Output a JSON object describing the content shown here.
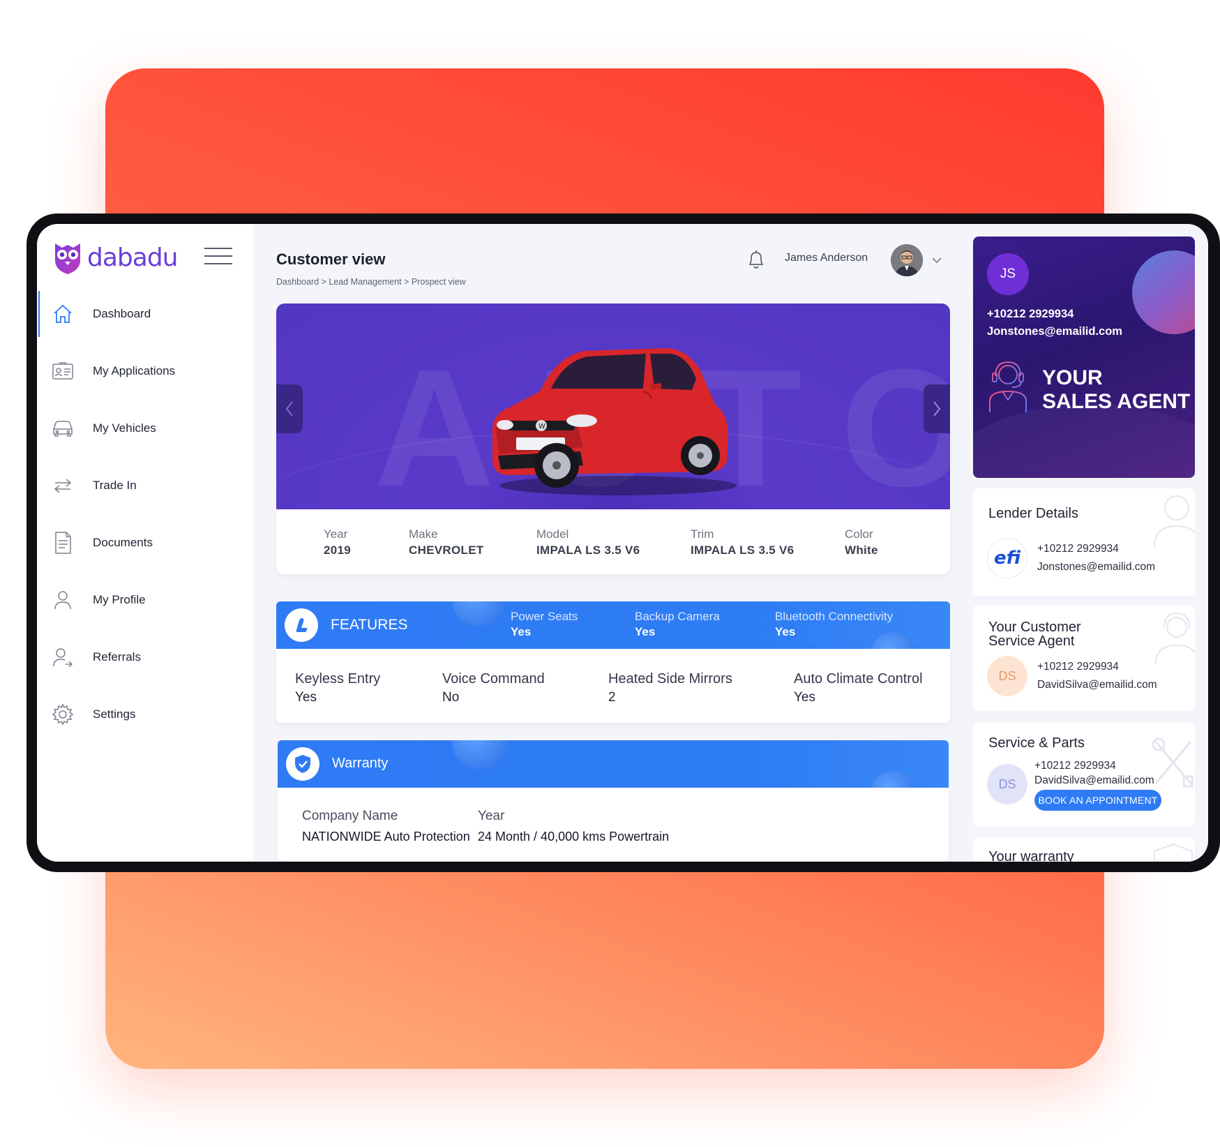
{
  "app": {
    "brand": "dabadu"
  },
  "sidebar": {
    "items": [
      {
        "label": "Dashboard",
        "icon": "home-icon",
        "active": true
      },
      {
        "label": "My Applications",
        "icon": "id-card-icon"
      },
      {
        "label": "My Vehicles",
        "icon": "car-icon"
      },
      {
        "label": "Trade In",
        "icon": "swap-arrows-icon"
      },
      {
        "label": "Documents",
        "icon": "document-icon"
      },
      {
        "label": "My Profile",
        "icon": "user-icon"
      },
      {
        "label": "Referrals",
        "icon": "user-share-icon"
      },
      {
        "label": "Settings",
        "icon": "gear-icon"
      }
    ]
  },
  "header": {
    "title": "Customer view",
    "breadcrumb": "Dashboard > Lead Management > Prospect view",
    "user_name": "James Anderson"
  },
  "hero": {
    "watermark": "AUTO"
  },
  "vehicle": {
    "specs": [
      {
        "label": "Year",
        "value": "2019"
      },
      {
        "label": "Make",
        "value": "CHEVROLET"
      },
      {
        "label": "Model",
        "value": "IMPALA LS 3.5 V6"
      },
      {
        "label": "Trim",
        "value": "IMPALA LS 3.5 V6"
      },
      {
        "label": "Color",
        "value": "White"
      }
    ]
  },
  "features": {
    "title": "FEATURES",
    "header_items": [
      {
        "label": "Power Seats",
        "value": "Yes"
      },
      {
        "label": "Backup Camera",
        "value": "Yes"
      },
      {
        "label": "Bluetooth Connectivity",
        "value": "Yes"
      }
    ],
    "items": [
      {
        "label": "Keyless Entry",
        "value": "Yes"
      },
      {
        "label": "Voice Command",
        "value": "No"
      },
      {
        "label": "Heated Side Mirrors",
        "value": "2"
      },
      {
        "label": "Auto Climate Control",
        "value": "Yes"
      }
    ]
  },
  "warranty": {
    "title": "Warranty",
    "company_label": "Company Name",
    "company_value": "NATIONWIDE Auto Protection",
    "year_label": "Year",
    "year_value": "24 Month / 40,000 kms Powertrain"
  },
  "sales_agent": {
    "initials": "JS",
    "phone": "+10212 2929934",
    "email": "Jonstones@emailid.com",
    "title_line1": "YOUR",
    "title_line2": "SALES AGENT"
  },
  "lender": {
    "title": "Lender Details",
    "logo_text": "efi",
    "phone": "+10212 2929934",
    "email": "Jonstones@emailid.com"
  },
  "service_agent": {
    "title_line1": "Your Customer",
    "title_line2": "Service Agent",
    "initials": "DS",
    "phone": "+10212 2929934",
    "email": "DavidSilva@emailid.com"
  },
  "service_parts": {
    "title": "Service & Parts",
    "initials": "DS",
    "phone": "+10212 2929934",
    "email": "DavidSilva@emailid.com",
    "button": "BOOK AN APPOINTMENT"
  },
  "your_warranty": {
    "title": "Your warranty"
  },
  "colors": {
    "accent": "#2f7bf5",
    "brand": "#6b3fd8",
    "hero": "#5237c2",
    "agent_card": "#2b1770"
  }
}
